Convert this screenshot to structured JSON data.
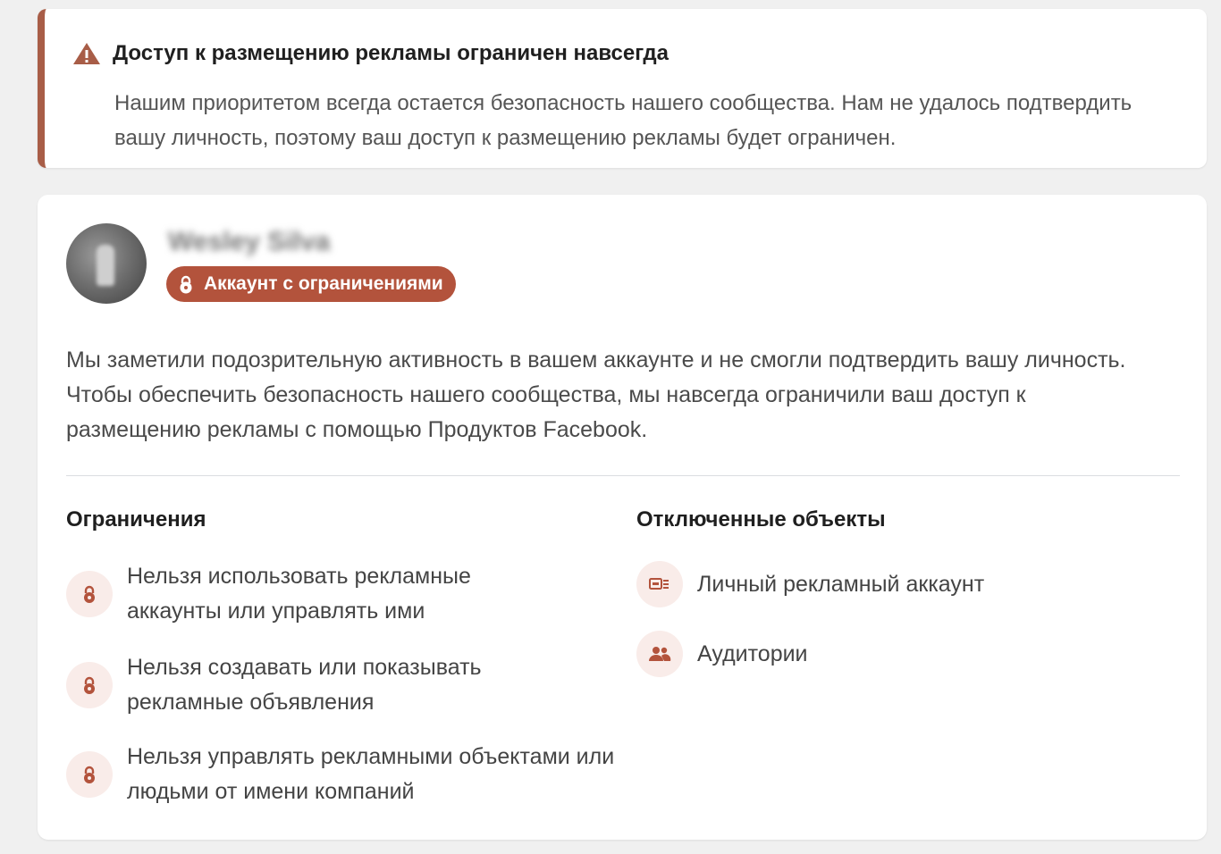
{
  "banner": {
    "icon": "warning-triangle-icon",
    "title": "Доступ к размещению рекламы ограничен навсегда",
    "body": "Нашим приоритетом всегда остается безопасность нашего сообщества. Нам не удалось подтвердить вашу личность, поэтому ваш доступ к размещению рекламы будет ограничен."
  },
  "profile": {
    "name": "Wesley Silva",
    "status_badge": "Аккаунт с ограничениями",
    "badge_icon": "lock-icon"
  },
  "description": "Мы заметили подозрительную активность в вашем аккаунте и не смогли подтвердить вашу личность. Чтобы обеспечить безопасность нашего сообщества, мы навсегда ограничили ваш доступ к размещению рекламы с помощью Продуктов Facebook.",
  "restrictions": {
    "title": "Ограничения",
    "items": [
      {
        "icon": "lock-icon",
        "label": "Нельзя использовать рекламные аккаунты или управлять ими"
      },
      {
        "icon": "lock-icon",
        "label": "Нельзя создавать или показывать рекламные объявления"
      },
      {
        "icon": "lock-icon",
        "label": "Нельзя управлять рекламными объектами или людьми от имени компаний"
      }
    ]
  },
  "disabled": {
    "title": "Отключенные объекты",
    "items": [
      {
        "icon": "ad-account-icon",
        "label": "Личный рекламный аккаунт"
      },
      {
        "icon": "audience-icon",
        "label": "Аудитории"
      }
    ]
  },
  "colors": {
    "accent": "#a85d47",
    "badge": "#b3533c",
    "icon_bg": "#f9ece9",
    "icon_fg": "#b3533c"
  }
}
